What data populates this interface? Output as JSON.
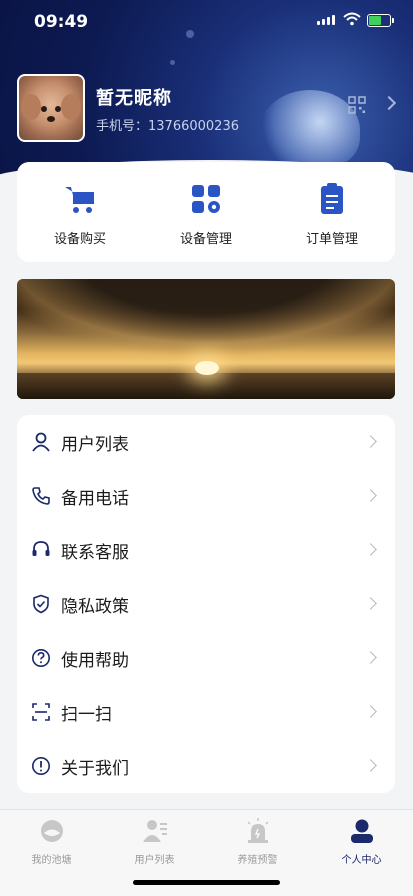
{
  "status": {
    "time": "09:49"
  },
  "profile": {
    "nickname": "暂无昵称",
    "phone": "手机号：13766000236"
  },
  "quick_actions": [
    {
      "label": "设备购买",
      "icon": "cart-icon"
    },
    {
      "label": "设备管理",
      "icon": "grid-gear-icon"
    },
    {
      "label": "订单管理",
      "icon": "clipboard-icon"
    }
  ],
  "menu": [
    {
      "label": "用户列表",
      "icon": "user-icon"
    },
    {
      "label": "备用电话",
      "icon": "phone-icon"
    },
    {
      "label": "联系客服",
      "icon": "headset-icon"
    },
    {
      "label": "隐私政策",
      "icon": "shield-icon"
    },
    {
      "label": "使用帮助",
      "icon": "help-icon"
    },
    {
      "label": "扫一扫",
      "icon": "scan-icon"
    },
    {
      "label": "关于我们",
      "icon": "info-icon"
    }
  ],
  "tabs": [
    {
      "label": "我的池塘",
      "icon": "pond-icon",
      "active": false
    },
    {
      "label": "用户列表",
      "icon": "user-list-icon",
      "active": false
    },
    {
      "label": "养殖预警",
      "icon": "alarm-icon",
      "active": false
    },
    {
      "label": "个人中心",
      "icon": "person-icon",
      "active": true
    }
  ],
  "colors": {
    "accent": "#2b55c4",
    "header_dark": "#0d1a52",
    "tab_active": "#1b2a6b"
  }
}
